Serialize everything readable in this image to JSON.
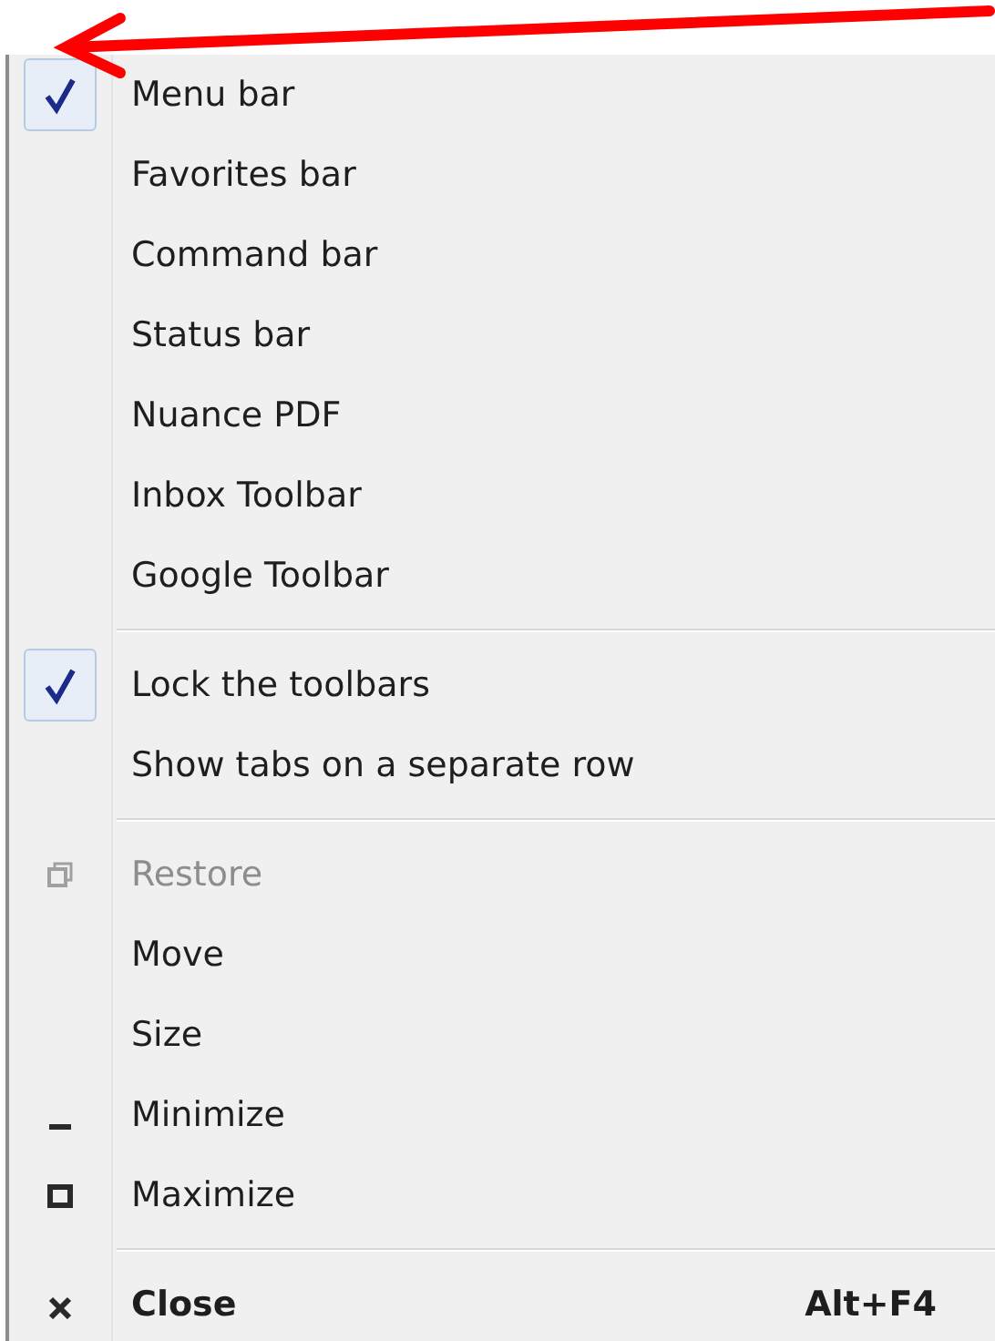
{
  "menu": {
    "items": [
      {
        "kind": "toggle",
        "label": "Menu bar",
        "checked": true
      },
      {
        "kind": "toggle",
        "label": "Favorites bar",
        "checked": false
      },
      {
        "kind": "toggle",
        "label": "Command bar",
        "checked": false
      },
      {
        "kind": "toggle",
        "label": "Status bar",
        "checked": false
      },
      {
        "kind": "toggle",
        "label": "Nuance PDF",
        "checked": false
      },
      {
        "kind": "toggle",
        "label": "Inbox Toolbar",
        "checked": false
      },
      {
        "kind": "toggle",
        "label": "Google Toolbar",
        "checked": false
      },
      {
        "kind": "separator"
      },
      {
        "kind": "toggle",
        "label": "Lock the toolbars",
        "checked": true
      },
      {
        "kind": "toggle",
        "label": "Show tabs on a separate row",
        "checked": false
      },
      {
        "kind": "separator"
      },
      {
        "kind": "restore",
        "label": "Restore",
        "disabled": true
      },
      {
        "kind": "plain",
        "label": "Move",
        "disabled": false
      },
      {
        "kind": "plain",
        "label": "Size",
        "disabled": false
      },
      {
        "kind": "minimize",
        "label": "Minimize",
        "disabled": false
      },
      {
        "kind": "maximize",
        "label": "Maximize",
        "disabled": false
      },
      {
        "kind": "separator"
      },
      {
        "kind": "close",
        "label": "Close",
        "shortcut": "Alt+F4",
        "disabled": false
      }
    ]
  }
}
